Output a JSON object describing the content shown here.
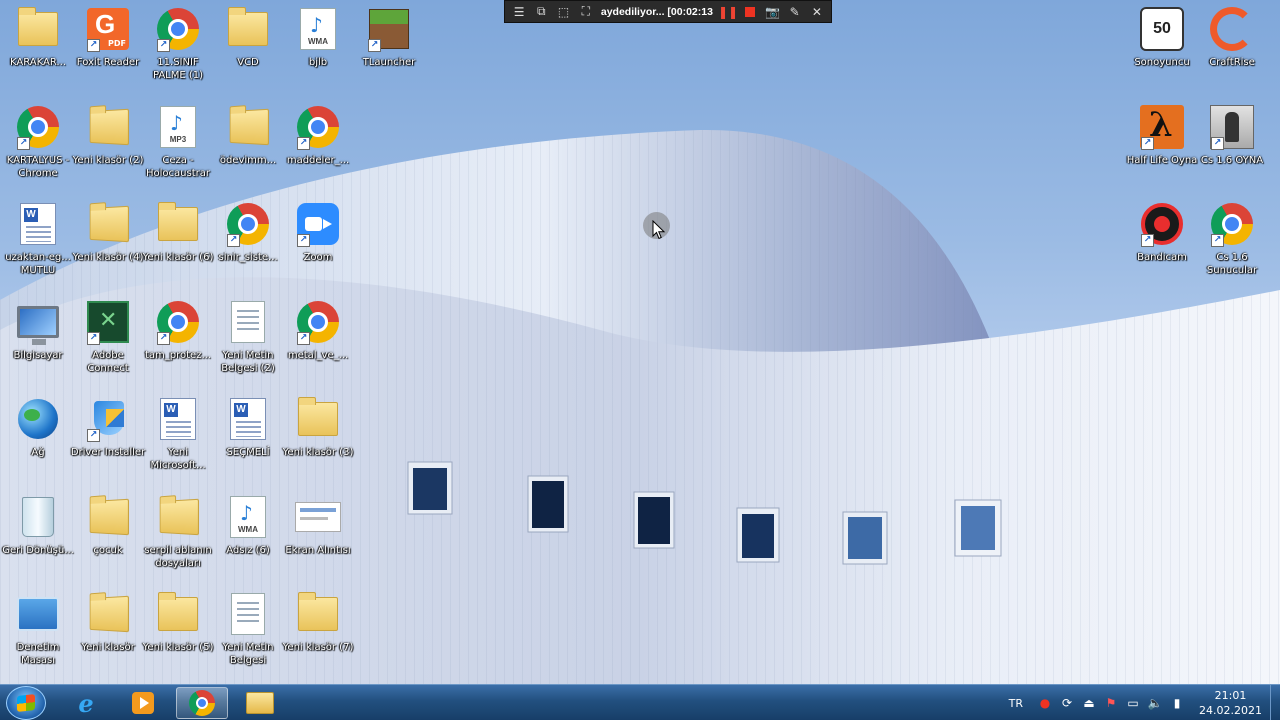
{
  "desktop": {
    "icons": [
      {
        "label": "KARAKAR...",
        "type": "folder-user"
      },
      {
        "label": "Foxit Reader",
        "type": "pdf"
      },
      {
        "label": "11.SINIF PALME (1)",
        "type": "chrome"
      },
      {
        "label": "VCD",
        "type": "folder"
      },
      {
        "label": "bjlb",
        "type": "wma"
      },
      {
        "label": "TLauncher",
        "type": "minecraft"
      },
      {
        "label": "KARTALYUS - Chrome",
        "type": "chrome"
      },
      {
        "label": "Yeni klasör (2)",
        "type": "folder"
      },
      {
        "label": "Ceza - Holocaustrar",
        "type": "mp3"
      },
      {
        "label": "ödevimm...",
        "type": "folder"
      },
      {
        "label": "maddeler_...",
        "type": "chrome"
      },
      {
        "label": "uzaktan-eg... MUTLU",
        "type": "word"
      },
      {
        "label": "Yeni klasör (4)",
        "type": "folder"
      },
      {
        "label": "Yeni klasör (6)",
        "type": "folder"
      },
      {
        "label": "sinir_siste...",
        "type": "chrome"
      },
      {
        "label": "Zoom",
        "type": "zoom"
      },
      {
        "label": "Bilgisayar",
        "type": "computer"
      },
      {
        "label": "Adobe Connect",
        "type": "adobe"
      },
      {
        "label": "tam_protez...",
        "type": "chrome"
      },
      {
        "label": "Yeni Metin Belgesi (2)",
        "type": "text"
      },
      {
        "label": "metal_ve_...",
        "type": "chrome"
      },
      {
        "label": "Ağ",
        "type": "network"
      },
      {
        "label": "Driver Installer",
        "type": "shield"
      },
      {
        "label": "Yeni Microsoft...",
        "type": "word"
      },
      {
        "label": "SEÇMELİ",
        "type": "word"
      },
      {
        "label": "Yeni klasör (3)",
        "type": "folder"
      },
      {
        "label": "Geri Dönüşü...",
        "type": "recycle"
      },
      {
        "label": "çocuk",
        "type": "folder"
      },
      {
        "label": "serpil ablanın dosyaları",
        "type": "folder"
      },
      {
        "label": "Adsız (6)",
        "type": "wma"
      },
      {
        "label": "Ekran Alıntısı",
        "type": "screenshot"
      },
      {
        "label": "Denetim Masası",
        "type": "control-panel"
      },
      {
        "label": "Yeni klasör",
        "type": "folder"
      },
      {
        "label": "Yeni klasör (5)",
        "type": "folder"
      },
      {
        "label": "Yeni Metin Belgesi",
        "type": "text"
      },
      {
        "label": "Yeni klasör (7)",
        "type": "folder"
      }
    ],
    "right_icons": [
      {
        "label": "Sonoyuncu",
        "type": "sonoyuncu",
        "badge": "50"
      },
      {
        "label": "CraftRise",
        "type": "craftrise"
      },
      {
        "label": "Half Life Oyna",
        "type": "halflife"
      },
      {
        "label": "Cs 1.6 OYNA",
        "type": "cs"
      },
      {
        "label": "Bandicam",
        "type": "bandicam"
      },
      {
        "label": "Cs 1.6 Sunucular",
        "type": "chrome"
      }
    ],
    "media_tags": {
      "wma": "WMA",
      "mp3": "MP3",
      "pdf": "PDF"
    }
  },
  "recorder": {
    "status_text": "aydediliyor... [00:02:13",
    "icons": [
      "menu-icon",
      "window-icon",
      "region-icon",
      "fullscreen-icon",
      "pause-icon",
      "stop-icon",
      "camera-icon",
      "pencil-icon",
      "close-icon"
    ]
  },
  "taskbar": {
    "language": "TR",
    "time": "21:01",
    "date": "24.02.2021",
    "pinned": [
      "internet-explorer",
      "media-player",
      "chrome",
      "file-explorer"
    ],
    "active": "chrome"
  },
  "colors": {
    "taskbar_top": "#3b6ea8",
    "taskbar_bottom": "#173e68",
    "sky": "#7fa7da",
    "record_red": "#e32222"
  }
}
